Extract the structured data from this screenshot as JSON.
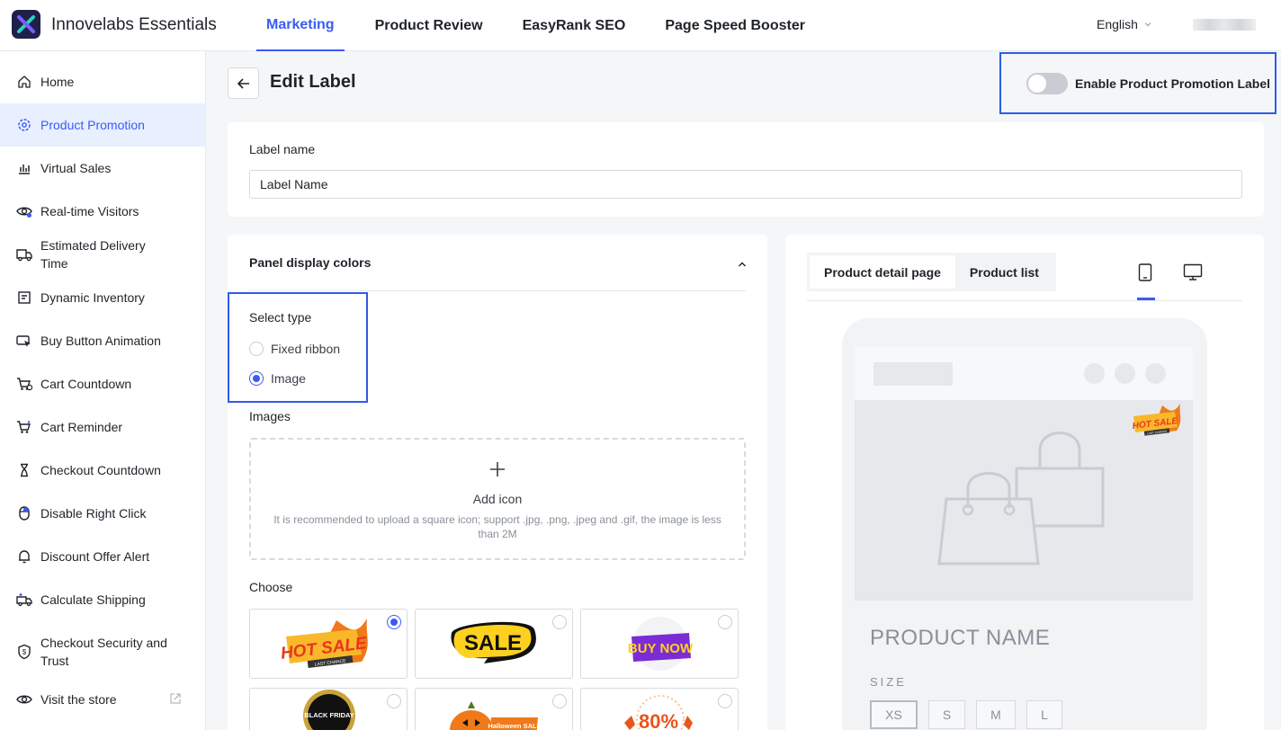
{
  "app": {
    "title": "Innovelabs Essentials",
    "language": "English"
  },
  "topnav": {
    "tabs": [
      "Marketing",
      "Product Review",
      "EasyRank SEO",
      "Page Speed Booster"
    ],
    "active": "Marketing"
  },
  "sidebar": {
    "items": [
      {
        "label": "Home",
        "icon": "home-icon"
      },
      {
        "label": "Product Promotion",
        "icon": "gear-icon",
        "active": true
      },
      {
        "label": "Virtual Sales",
        "icon": "bar-chart-icon"
      },
      {
        "label": "Real-time Visitors",
        "icon": "eye-icon"
      },
      {
        "label": "Estimated Delivery Time",
        "icon": "truck-icon"
      },
      {
        "label": "Dynamic Inventory",
        "icon": "inventory-icon"
      },
      {
        "label": "Buy Button Animation",
        "icon": "cursor-icon"
      },
      {
        "label": "Cart Countdown",
        "icon": "cart-icon"
      },
      {
        "label": "Cart Reminder",
        "icon": "cart-icon"
      },
      {
        "label": "Checkout Countdown",
        "icon": "hourglass-icon"
      },
      {
        "label": "Disable Right Click",
        "icon": "mouse-icon"
      },
      {
        "label": "Discount Offer Alert",
        "icon": "bell-icon"
      },
      {
        "label": "Calculate Shipping",
        "icon": "shipping-icon"
      },
      {
        "label": "Checkout Security and Trust",
        "icon": "shield-icon"
      },
      {
        "label": "Visit the store",
        "icon": "eye-icon"
      }
    ]
  },
  "page": {
    "title": "Edit Label",
    "enable_label": "Enable Product Promotion Label",
    "enabled": false
  },
  "label_name": {
    "label": "Label name",
    "value": "Label Name"
  },
  "panel": {
    "title": "Panel display colors",
    "select_type_label": "Select type",
    "types": [
      "Fixed ribbon",
      "Image"
    ],
    "selected_type": "Image",
    "images_label": "Images",
    "upload": {
      "title": "Add icon",
      "hint": "It is recommended to upload a square icon; support .jpg, .png, .jpeg and .gif, the image is less than 2M"
    },
    "choose_label": "Choose",
    "choices": [
      {
        "name": "HOT SALE",
        "sub": "LAST CHANCE",
        "selected": true
      },
      {
        "name": "SALE",
        "selected": false
      },
      {
        "name": "BUY NOW",
        "selected": false
      },
      {
        "name": "BLACK FRIDAY",
        "selected": false
      },
      {
        "name": "Halloween SALE",
        "selected": false
      },
      {
        "name": "80%",
        "selected": false
      }
    ]
  },
  "preview": {
    "tabs": [
      "Product detail page",
      "Product list"
    ],
    "active_tab": "Product detail page",
    "badge_text": "HOT SALE",
    "badge_sub": "LAST CHANCE",
    "product_name": "PRODUCT NAME",
    "size_label": "SIZE",
    "sizes": [
      "XS",
      "S",
      "M",
      "L"
    ],
    "selected_size": "XS"
  }
}
